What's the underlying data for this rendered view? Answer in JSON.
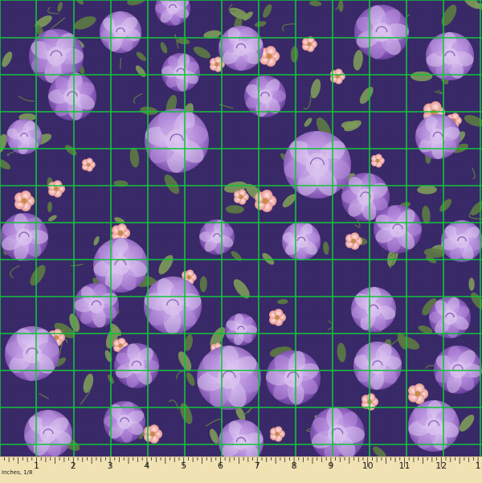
{
  "image": {
    "subject": "purple floral fabric swatch",
    "background_color": "#3a2a6a",
    "grid_color": "#12c43a",
    "palette": {
      "rose_light": "#d9c2ee",
      "rose_mid": "#b48cdb",
      "rose_dark": "#8a5cb8",
      "blossom_pink": "#f2b6b0",
      "blossom_center": "#c98a4a",
      "leaf": "#7e9a5a",
      "leaf_dark": "#5d7a42"
    }
  },
  "ruler": {
    "unit_label": "Inches, 1/8",
    "numbers": [
      "1",
      "2",
      "3",
      "4",
      "5",
      "6",
      "7",
      "8",
      "9",
      "10",
      "11",
      "12",
      "1"
    ],
    "background": "#f1e2b3"
  }
}
